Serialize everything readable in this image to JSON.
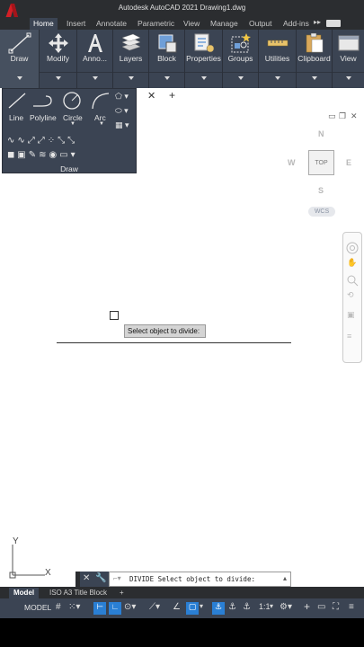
{
  "window": {
    "title": "Autodesk AutoCAD 2021    Drawing1.dwg"
  },
  "ribbon_tabs": [
    "Home",
    "Insert",
    "Annotate",
    "Parametric",
    "View",
    "Manage",
    "Output",
    "Add-ins"
  ],
  "ribbon_panels": [
    "Draw",
    "Modify",
    "Anno...",
    "Layers",
    "Block",
    "Properties",
    "Groups",
    "Utilities",
    "Clipboard",
    "View"
  ],
  "draw_flyout": {
    "tools": [
      "Line",
      "Polyline",
      "Circle",
      "Arc"
    ],
    "title": "Draw"
  },
  "viewcube": {
    "face": "TOP",
    "north": "N",
    "south": "S",
    "east": "E",
    "west": "W",
    "wcs": "WCS"
  },
  "canvas": {
    "tooltip": "Select object to divide:"
  },
  "ucs": {
    "x": "X",
    "y": "Y"
  },
  "command_line": {
    "text": "DIVIDE Select object to divide:"
  },
  "layout_tabs": [
    "Model",
    "ISO A3 Title Block"
  ],
  "status_bar": {
    "model_label": "MODEL",
    "scale": "1:1"
  },
  "colors": {
    "ribbon": "#3b4453",
    "titlebar": "#2b2d30",
    "accent": "#2a7fd4",
    "logo": "#d31f26"
  }
}
